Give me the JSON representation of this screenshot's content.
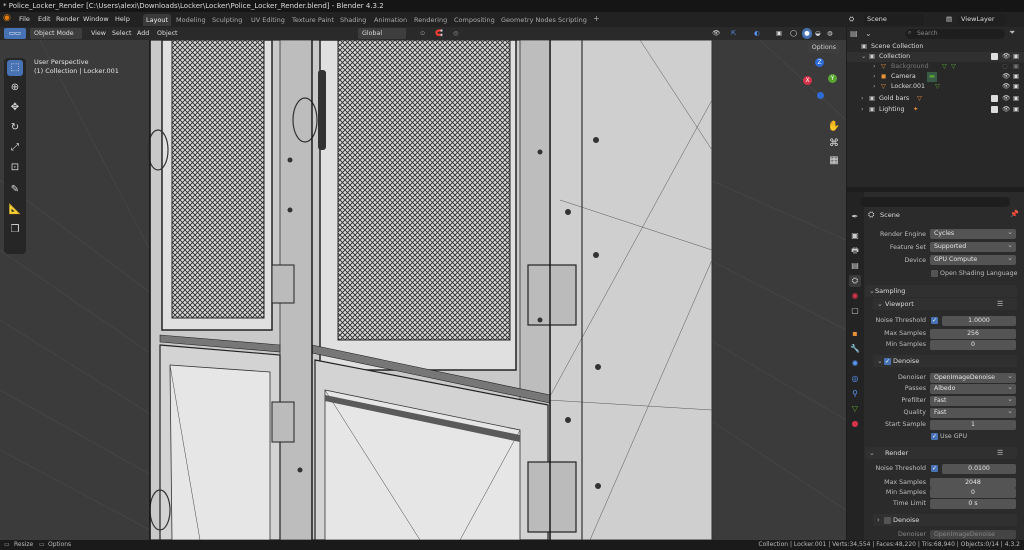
{
  "window": {
    "title": "* Police_Locker_Render [C:\\Users\\alexi\\Downloads\\Locker\\Locker\\Police_Locker_Render.blend] - Blender 4.3.2"
  },
  "menu": [
    "File",
    "Edit",
    "Render",
    "Window",
    "Help"
  ],
  "workspaces": [
    "Layout",
    "Modeling",
    "Sculpting",
    "UV Editing",
    "Texture Paint",
    "Shading",
    "Animation",
    "Rendering",
    "Compositing",
    "Geometry Nodes",
    "Scripting"
  ],
  "workspace_add": "+",
  "scene_selector": {
    "label": "Scene",
    "viewlayer": "ViewLayer"
  },
  "viewport_header": {
    "mode": "Object Mode",
    "view": "View",
    "select": "Select",
    "add": "Add",
    "object": "Object",
    "orientation": "Global",
    "options": "Options"
  },
  "viewport": {
    "perspective": "User Perspective",
    "collection": "(1) Collection | Locker.001"
  },
  "gizmo": {
    "x": "X",
    "y": "Y",
    "z": "Z"
  },
  "outliner": {
    "search_placeholder": "Search",
    "items": [
      {
        "label": "Scene Collection",
        "indent": 0
      },
      {
        "label": "Collection",
        "indent": 1
      },
      {
        "label": "Background",
        "indent": 2
      },
      {
        "label": "Camera",
        "indent": 2
      },
      {
        "label": "Locker.001",
        "indent": 2
      },
      {
        "label": "Gold bars",
        "indent": 1
      },
      {
        "label": "Lighting",
        "indent": 1
      }
    ]
  },
  "properties": {
    "header": "Scene",
    "render_engine": {
      "label": "Render Engine",
      "value": "Cycles"
    },
    "feature_set": {
      "label": "Feature Set",
      "value": "Supported"
    },
    "device": {
      "label": "Device",
      "value": "GPU Compute"
    },
    "osl": "Open Shading Language",
    "sampling": "Sampling",
    "viewport_panel": {
      "title": "Viewport",
      "noise_threshold": {
        "label": "Noise Threshold",
        "value": "1.0000"
      },
      "max_samples": {
        "label": "Max Samples",
        "value": "256"
      },
      "min_samples": {
        "label": "Min Samples",
        "value": "0"
      }
    },
    "denoise_panel": {
      "title": "Denoise",
      "denoiser": {
        "label": "Denoiser",
        "value": "OpenImageDenoise"
      },
      "passes": {
        "label": "Passes",
        "value": "Albedo"
      },
      "prefilter": {
        "label": "Prefilter",
        "value": "Fast"
      },
      "quality": {
        "label": "Quality",
        "value": "Fast"
      },
      "start_sample": {
        "label": "Start Sample",
        "value": "1"
      },
      "use_gpu": "Use GPU"
    },
    "render_panel": {
      "title": "Render",
      "noise_threshold": {
        "label": "Noise Threshold",
        "value": "0.0100"
      },
      "max_samples": {
        "label": "Max Samples",
        "value": "2048"
      },
      "min_samples": {
        "label": "Min Samples",
        "value": "0"
      },
      "time_limit": {
        "label": "Time Limit",
        "value": "0 s"
      }
    },
    "render_denoise": {
      "title": "Denoise",
      "denoiser_label": "Denoiser",
      "denoiser_value": "OpenImageDenoise"
    }
  },
  "status": {
    "resize": "Resize",
    "options": "Options",
    "stats": "Collection | Locker.001 | Verts:34,554 | Faces:48,220 | Tris:68,940 | Objects:0/14 | 4.3.2"
  },
  "colors": {
    "accent": "#4772b3",
    "panel": "#2b2b2b",
    "viewport": "#3b3b3b"
  }
}
